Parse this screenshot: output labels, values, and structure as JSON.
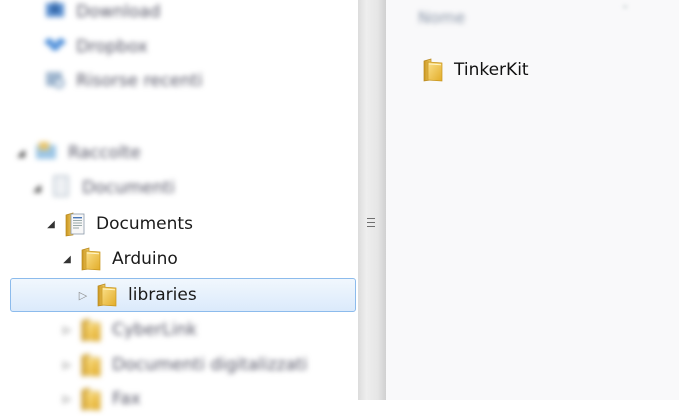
{
  "nav": {
    "items": [
      {
        "label": "Download",
        "blurred": true,
        "icon": "download-folder-icon"
      },
      {
        "label": "Dropbox",
        "blurred": true,
        "icon": "dropbox-icon"
      },
      {
        "label": "Risorse recenti",
        "blurred": true,
        "icon": "recent-places-icon"
      },
      {
        "label": "Raccolte",
        "blurred": true,
        "icon": "libraries-icon"
      },
      {
        "label": "Documenti",
        "blurred": true,
        "icon": "documents-library-icon"
      },
      {
        "label": "Documents",
        "blurred": false,
        "icon": "document-folder-icon"
      },
      {
        "label": "Arduino",
        "blurred": false,
        "icon": "folder-icon"
      },
      {
        "label": "libraries",
        "blurred": false,
        "icon": "folder-icon",
        "selected": true
      },
      {
        "label": "CyberLink",
        "blurred": true,
        "icon": "folder-icon"
      },
      {
        "label": "Documenti digitalizzati",
        "blurred": true,
        "icon": "folder-icon"
      },
      {
        "label": "Fax",
        "blurred": true,
        "icon": "folder-icon"
      }
    ]
  },
  "content": {
    "column_header": "Nome",
    "files": [
      {
        "name": "TinkerKit",
        "icon": "folder-icon"
      }
    ]
  },
  "colors": {
    "selection_border": "#8cbbec",
    "selection_fill": "#dbeafb",
    "folder_yellow": "#f2c94c"
  }
}
